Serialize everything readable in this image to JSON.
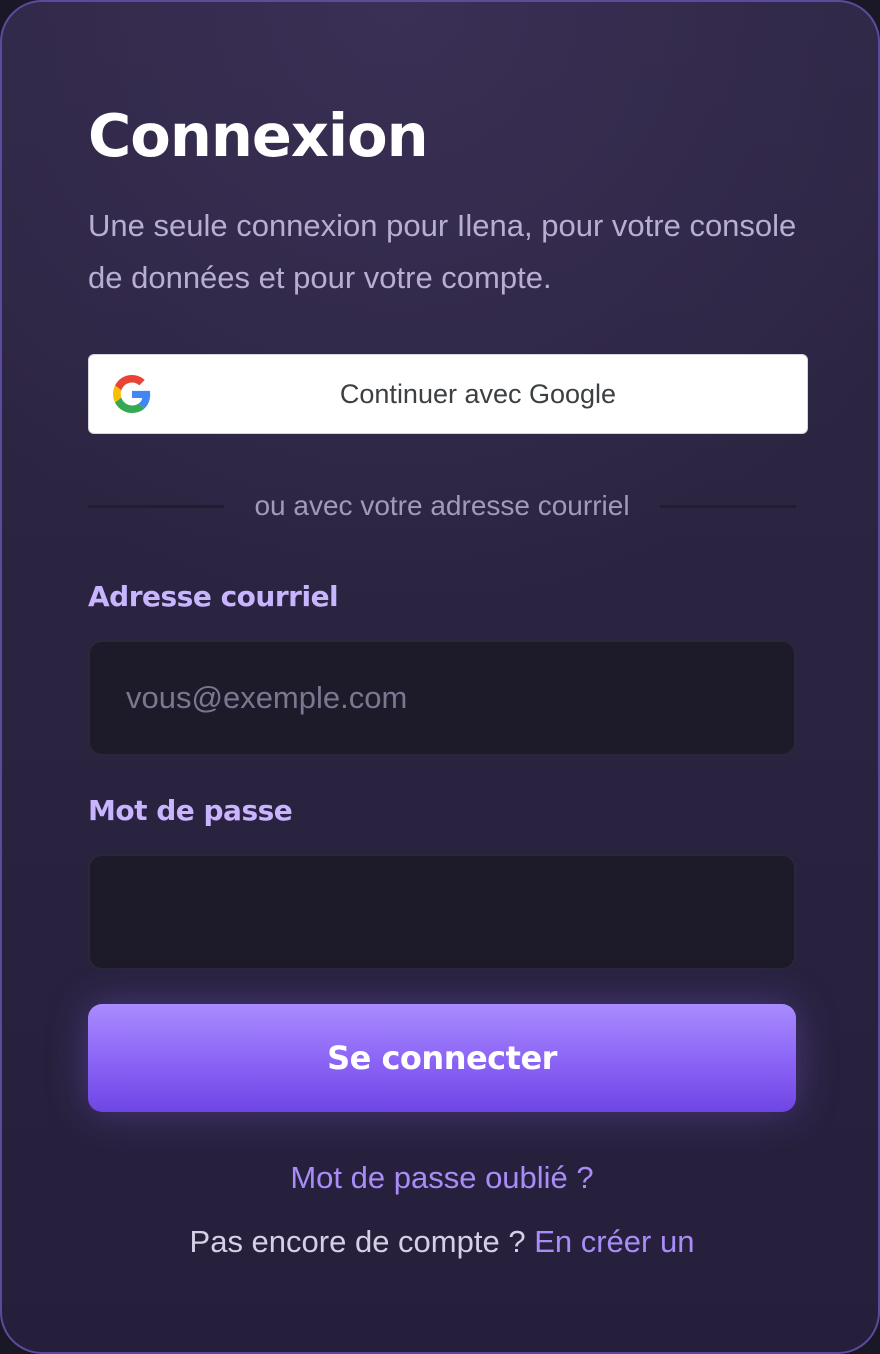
{
  "login": {
    "title": "Connexion",
    "subtitle": "Une seule connexion pour Ilena, pour votre console de données et pour votre compte.",
    "google_button": {
      "label": "Continuer avec Google",
      "icon": "google-icon"
    },
    "divider_text": "ou avec votre adresse courriel",
    "email": {
      "label": "Adresse courriel",
      "placeholder": "vous@exemple.com",
      "value": ""
    },
    "password": {
      "label": "Mot de passe",
      "placeholder": "",
      "value": ""
    },
    "submit_label": "Se connecter",
    "forgot_password": "Mot de passe oublié ?",
    "signup_prompt": "Pas encore de compte ?",
    "signup_link": "En créer un"
  },
  "colors": {
    "accent": "#8a63f5",
    "link": "#a98cf8",
    "label": "#c9b4ff",
    "card_background": "#2a2440",
    "input_background": "#1d1a29"
  }
}
